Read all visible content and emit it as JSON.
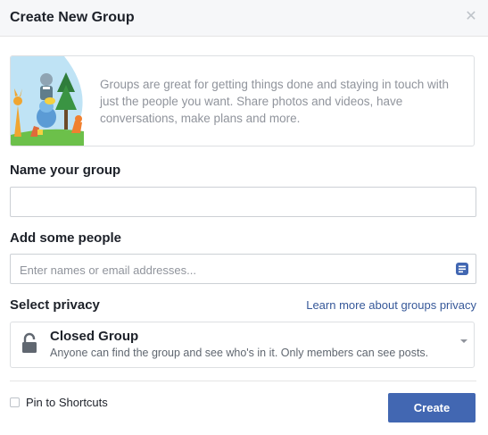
{
  "dialog": {
    "title": "Create New Group",
    "close_icon": "close-icon"
  },
  "intro": {
    "illustration": "groups-illustration",
    "text": "Groups are great for getting things done and staying in touch with just the people you want. Share photos and videos, have conversations, make plans and more."
  },
  "name_section": {
    "label": "Name your group",
    "value": ""
  },
  "people_section": {
    "label": "Add some people",
    "placeholder": "Enter names or email addresses...",
    "icon": "contacts-list-icon"
  },
  "privacy_section": {
    "label": "Select privacy",
    "link": "Learn more about groups privacy",
    "selected": {
      "title": "Closed Group",
      "description": "Anyone can find the group and see who's in it. Only members can see posts.",
      "icon": "lock-icon"
    }
  },
  "footer": {
    "pin_label": "Pin to Shortcuts",
    "pin_checked": false,
    "create_label": "Create"
  },
  "colors": {
    "accent": "#4267b2",
    "link": "#365899",
    "header_bg": "#f6f7f9",
    "muted_text": "#90949c"
  }
}
